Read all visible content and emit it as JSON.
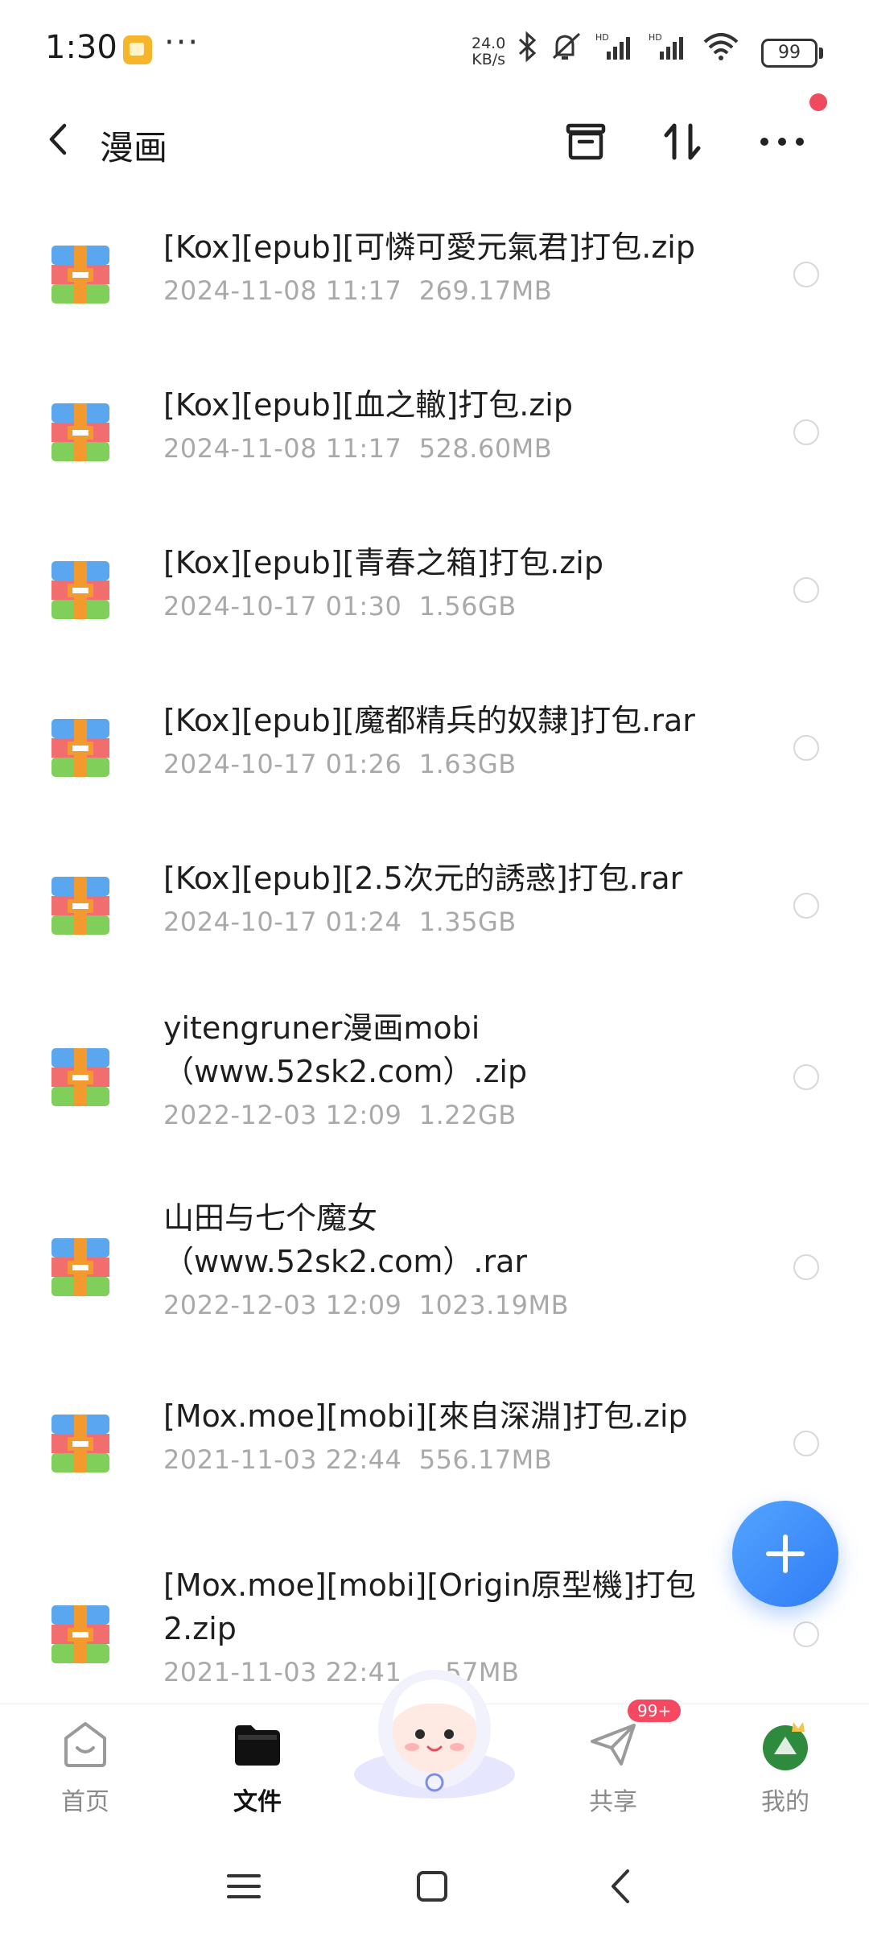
{
  "status_bar": {
    "time": "1:30",
    "more": "···",
    "net_speed_value": "24.0",
    "net_speed_unit": "KB/s",
    "battery": "99"
  },
  "header": {
    "title": "漫画",
    "notification_dot_color": "#f04a5e"
  },
  "files": [
    {
      "name": "[Kox][epub][可憐可愛元氣君]打包.zip",
      "date": "2024-11-08  11:17",
      "size": "269.17MB"
    },
    {
      "name": "[Kox][epub][血之轍]打包.zip",
      "date": "2024-11-08  11:17",
      "size": "528.60MB"
    },
    {
      "name": "[Kox][epub][青春之箱]打包.zip",
      "date": "2024-10-17  01:30",
      "size": "1.56GB"
    },
    {
      "name": "[Kox][epub][魔都精兵的奴隸]打包.rar",
      "date": "2024-10-17  01:26",
      "size": "1.63GB"
    },
    {
      "name": "[Kox][epub][2.5次元的誘惑]打包.rar",
      "date": "2024-10-17  01:24",
      "size": "1.35GB"
    },
    {
      "name": "yitengruner漫画mobi\n（www.52sk2.com）.zip",
      "date": "2022-12-03  12:09",
      "size": "1.22GB"
    },
    {
      "name": "山田与七个魔女\n（www.52sk2.com）.rar",
      "date": "2022-12-03  12:09",
      "size": "1023.19MB"
    },
    {
      "name": "[Mox.moe][mobi][來自深淵]打包.zip",
      "date": "2021-11-03  22:44",
      "size": "556.17MB"
    },
    {
      "name": "[Mox.moe][mobi][Origin原型機]打包\n2.zip",
      "date": "2021-11-03  22:41",
      "size": "…57MB"
    }
  ],
  "bottom_nav": {
    "home": "首页",
    "files": "文件",
    "share": "共享",
    "share_badge": "99+",
    "me": "我的"
  },
  "colors": {
    "accent": "#2f7cf6",
    "badge": "#f44960",
    "meta_text": "#a9a9a9"
  }
}
